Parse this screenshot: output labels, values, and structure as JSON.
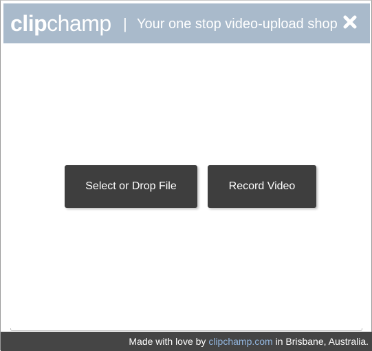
{
  "header": {
    "logo_bold": "clip",
    "logo_light": "champ",
    "divider": "|",
    "tagline": "Your one stop video-upload shop",
    "close_icon": "close-x-icon"
  },
  "actions": {
    "select_file_label": "Select or Drop File",
    "record_video_label": "Record Video"
  },
  "footer": {
    "prefix": "Made with love by ",
    "link_text": "clipchamp.com",
    "suffix": " in Brisbane, Australia."
  },
  "colors": {
    "header_bg": "#a9bacb",
    "button_bg": "#3e3e3e",
    "footer_bg": "#454545",
    "link": "#93b7e0"
  }
}
